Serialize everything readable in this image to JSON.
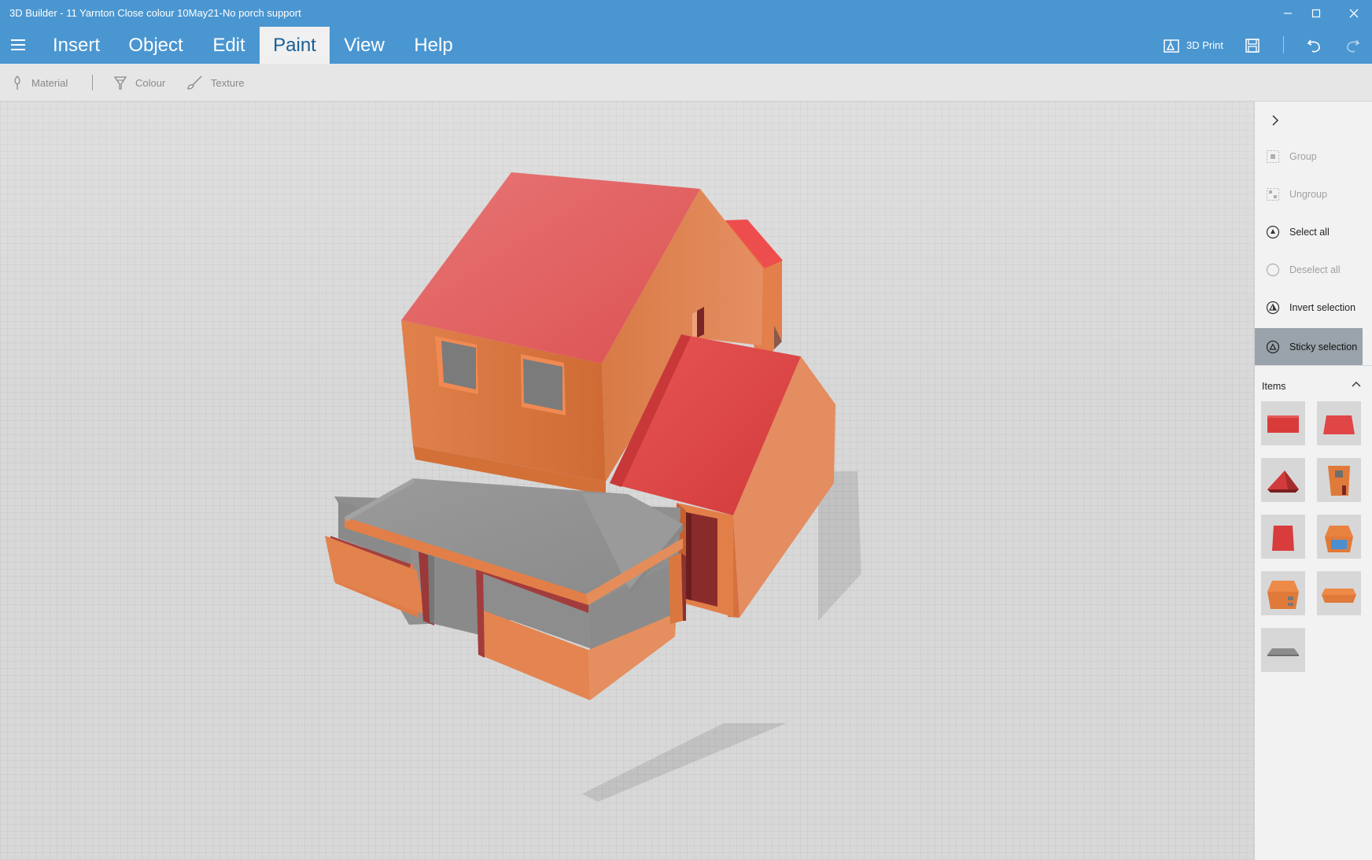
{
  "window": {
    "title": "3D Builder - 11 Yarnton Close colour 10May21-No porch support",
    "controls": [
      "minimize-icon",
      "maximize-icon",
      "close-icon"
    ]
  },
  "menu": {
    "tabs": [
      {
        "label": "Insert",
        "active": false
      },
      {
        "label": "Object",
        "active": false
      },
      {
        "label": "Edit",
        "active": false
      },
      {
        "label": "Paint",
        "active": true
      },
      {
        "label": "View",
        "active": false
      },
      {
        "label": "Help",
        "active": false
      }
    ],
    "print_label": "3D Print",
    "icons": [
      "hamburger-icon",
      "print-3d-icon",
      "save-icon",
      "undo-icon",
      "redo-icon"
    ]
  },
  "ribbon": {
    "material": "Material",
    "colour": "Colour",
    "texture": "Texture"
  },
  "panel": {
    "actions": [
      {
        "label": "Group",
        "enabled": false
      },
      {
        "label": "Ungroup",
        "enabled": false
      },
      {
        "label": "Select all",
        "enabled": true
      },
      {
        "label": "Deselect all",
        "enabled": false
      },
      {
        "label": "Invert selection",
        "enabled": true
      },
      {
        "label": "Sticky selection",
        "enabled": true,
        "selected": true
      }
    ],
    "items_label": "Items",
    "items": [
      {
        "name": "red-slab",
        "color": "#d93b3b"
      },
      {
        "name": "red-block",
        "color": "#e04646"
      },
      {
        "name": "red-gable-roof",
        "color": "#cc3a3a"
      },
      {
        "name": "orange-wall-with-window",
        "color": "#e07a3a"
      },
      {
        "name": "red-wall",
        "color": "#d83c3c"
      },
      {
        "name": "orange-box-with-blue",
        "color": "#e9823f"
      },
      {
        "name": "orange-house-block",
        "color": "#e9823f"
      },
      {
        "name": "orange-slab",
        "color": "#e9823f"
      },
      {
        "name": "grey-slab",
        "color": "#8c8c8c"
      }
    ]
  },
  "colors": {
    "accent": "#4a96d1",
    "roof_red": "#e25a5a",
    "wall_orange": "#df7a45",
    "flat_roof_grey": "#999999"
  }
}
